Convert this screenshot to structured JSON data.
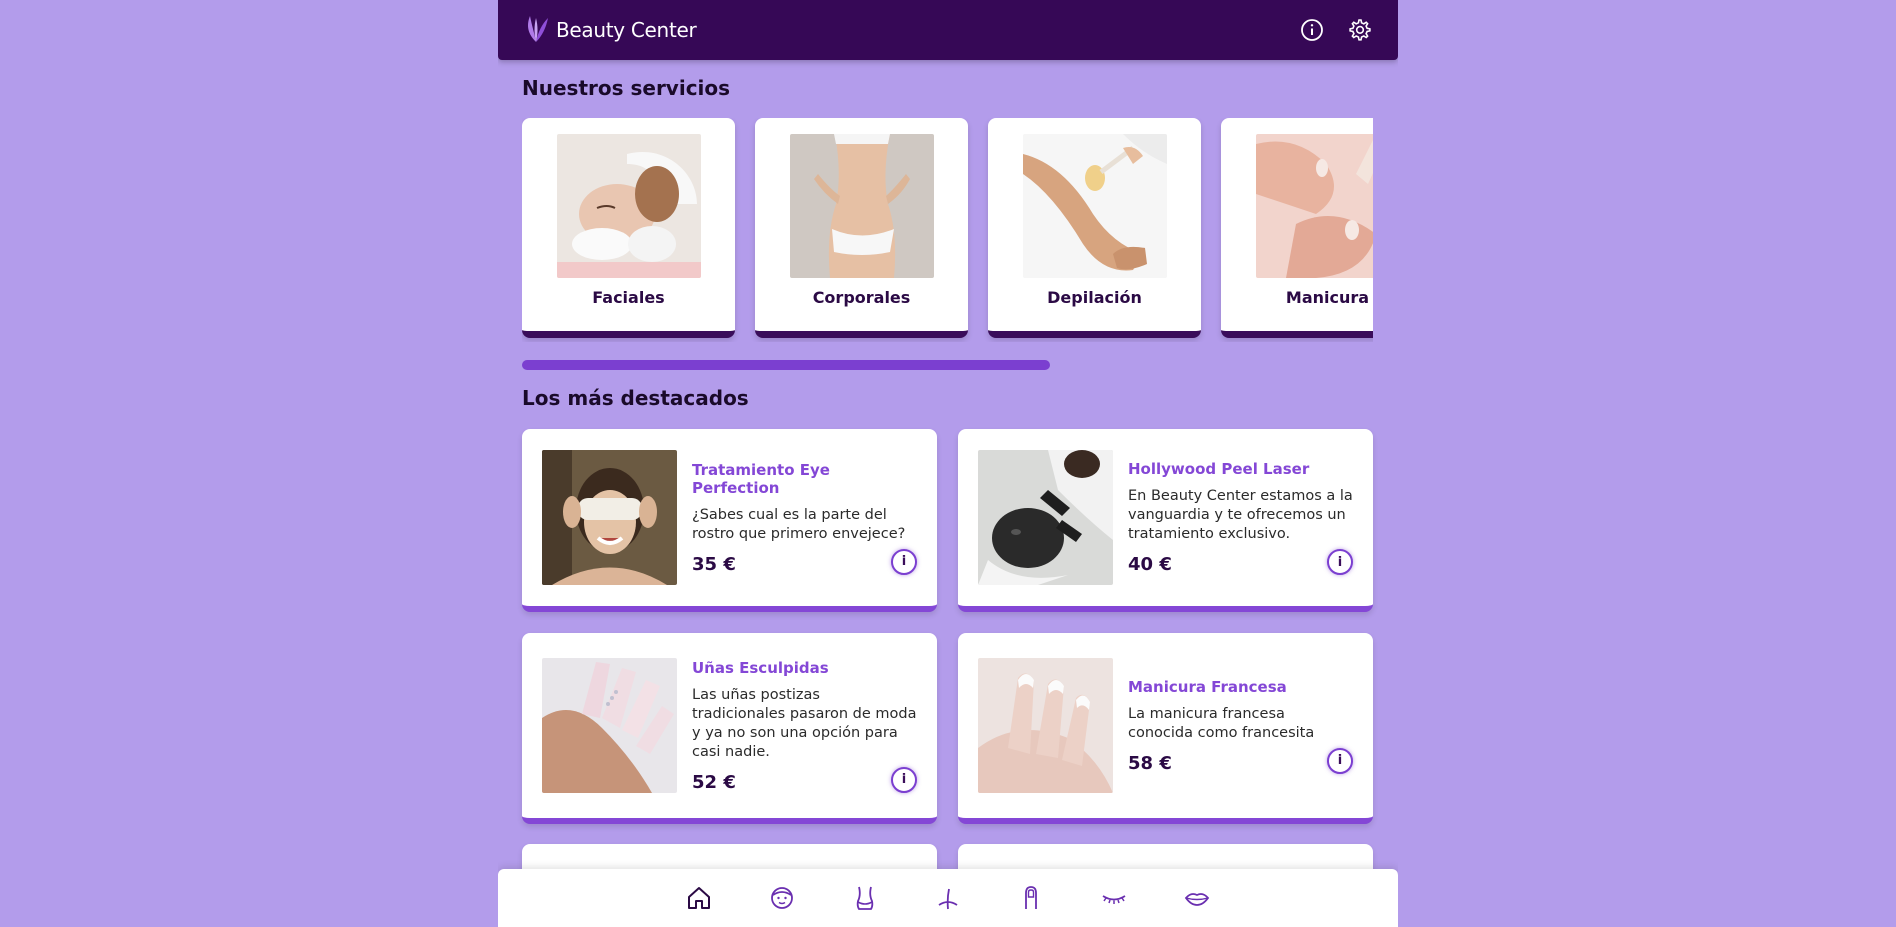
{
  "header": {
    "brand": "Beauty Center",
    "icons": [
      "leaf-logo-icon",
      "info-icon",
      "gear-icon"
    ]
  },
  "services": {
    "title": "Nuestros servicios",
    "items": [
      {
        "label": "Faciales",
        "image": "facial-treatment-photo"
      },
      {
        "label": "Corporales",
        "image": "body-photo"
      },
      {
        "label": "Depilación",
        "image": "waxing-photo"
      },
      {
        "label": "Manicura",
        "image": "manicure-photo"
      }
    ],
    "scroll_progress": 0.62
  },
  "featured": {
    "title": "Los más destacados",
    "items": [
      {
        "title": "Tratamiento Eye Perfection",
        "desc": "¿Sabes cual es la parte del rostro que primero envejece?",
        "price": "35 €"
      },
      {
        "title": "Hollywood Peel Laser",
        "desc": "En Beauty Center estamos a la vanguardia y te ofrecemos un tratamiento exclusivo.",
        "price": "40 €"
      },
      {
        "title": "Uñas Esculpidas",
        "desc": "Las uñas postizas tradicionales pasaron de moda y ya no son una opción para casi nadie.",
        "price": "52 €"
      },
      {
        "title": "Manicura Francesa",
        "desc": "La manicura francesa conocida como francesita",
        "price": "58 €"
      }
    ],
    "info_label": "i"
  },
  "bottom_nav": [
    "home-icon",
    "face-icon",
    "body-icon",
    "hair-removal-icon",
    "nail-icon",
    "eyelash-icon",
    "lips-icon"
  ],
  "colors": {
    "background": "#b39ceb",
    "header": "#360856",
    "accent": "#8447d6",
    "dark": "#2b0a45"
  }
}
